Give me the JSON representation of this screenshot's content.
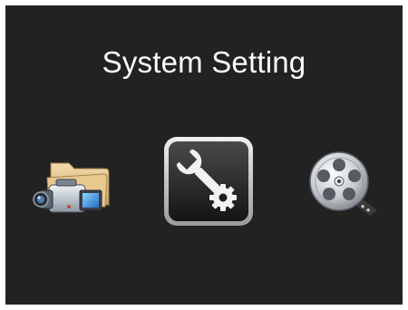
{
  "screen": {
    "title": "System Setting"
  },
  "menu": {
    "items": [
      {
        "icon": "camcorder-folder-icon",
        "selected": false
      },
      {
        "icon": "wrench-gear-settings-icon",
        "selected": true
      },
      {
        "icon": "film-reel-icon",
        "selected": false
      }
    ]
  },
  "colors": {
    "background": "#222222",
    "title_text": "#ffffff",
    "selection_frame": "#d0d0d0"
  }
}
